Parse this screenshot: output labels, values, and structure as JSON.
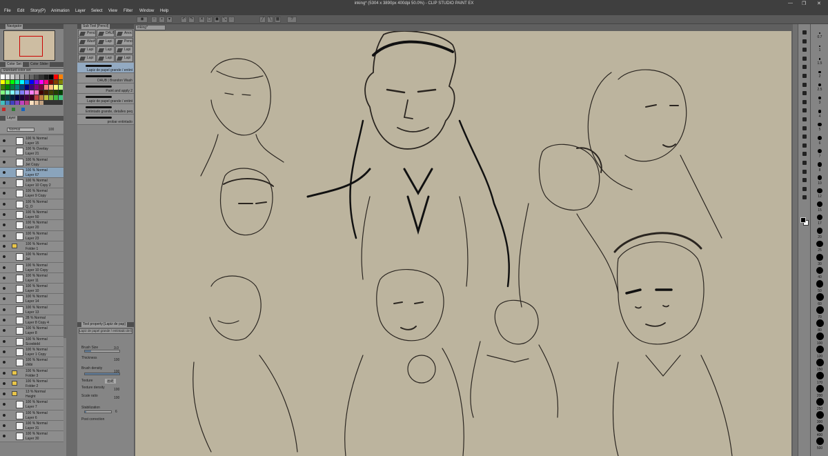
{
  "window": {
    "title": "inking* (5304 x 3890px 400dpi 50.0%) - CLIP STUDIO PAINT EX",
    "controls": [
      "—",
      "❐",
      "✕"
    ]
  },
  "menu": [
    "File",
    "Edit",
    "Story(P)",
    "Animation",
    "Layer",
    "Select",
    "View",
    "Filter",
    "Window",
    "Help"
  ],
  "navigator": {
    "title": "Navigator"
  },
  "colorset": {
    "tabs": [
      "Color Set",
      "Color Slider"
    ],
    "selected": "Standard color set"
  },
  "colors": [
    "#ffffff",
    "#e6e6e6",
    "#cccccc",
    "#b3b3b3",
    "#999999",
    "#808080",
    "#666666",
    "#4d4d4d",
    "#333333",
    "#1a1a1a",
    "#000000",
    "#ff0000",
    "#ff8000",
    "#ffff00",
    "#80ff00",
    "#00ff00",
    "#00ff80",
    "#00ffff",
    "#0080ff",
    "#0000ff",
    "#8000ff",
    "#ff00ff",
    "#ff0080",
    "#800000",
    "#804000",
    "#808000",
    "#408000",
    "#008000",
    "#008040",
    "#008080",
    "#004080",
    "#000080",
    "#400080",
    "#800080",
    "#800040",
    "#ff8080",
    "#ffc080",
    "#ffff80",
    "#c0ff80",
    "#80ff80",
    "#80ffc0",
    "#80ffff",
    "#80c0ff",
    "#8080ff",
    "#c080ff",
    "#ff80ff",
    "#ff80c0",
    "#400000",
    "#402000",
    "#404000",
    "#204000",
    "#004000",
    "#004020",
    "#004040",
    "#002040",
    "#000040",
    "#200040",
    "#400040",
    "#400020",
    "#c04040",
    "#c08040",
    "#c0c040",
    "#80c040",
    "#40c040",
    "#40c080",
    "#40c0c0",
    "#4080c0",
    "#4040c0",
    "#8040c0",
    "#c040c0",
    "#c04080",
    "#ffe0c0",
    "#e0c0a0",
    "#c0a080"
  ],
  "layer": {
    "tab": "Layer",
    "blend_mode": "Normal",
    "opacity": "100",
    "rows": [
      {
        "line1": "100 % Normal",
        "line2": "Layer 15",
        "folder": false,
        "selected": false
      },
      {
        "line1": "100 % Overlay",
        "line2": "Layer 21",
        "folder": false,
        "selected": false
      },
      {
        "line1": "100 % Normal",
        "line2": "Jet Copy",
        "folder": false,
        "selected": false
      },
      {
        "line1": "100 % Normal",
        "line2": "Layer 67",
        "folder": false,
        "selected": true
      },
      {
        "line1": "100 % Normal",
        "line2": "Layer 10 Copy 2",
        "folder": false,
        "selected": false
      },
      {
        "line1": "100 % Normal",
        "line2": "Layer 9 Copy",
        "folder": false,
        "selected": false
      },
      {
        "line1": "100 % Normal",
        "line2": "Q_O",
        "folder": false,
        "selected": false
      },
      {
        "line1": "100 % Normal",
        "line2": "Layer 50",
        "folder": false,
        "selected": false
      },
      {
        "line1": "100 % Normal",
        "line2": "Layer 20",
        "folder": false,
        "selected": false
      },
      {
        "line1": "100 % Normal",
        "line2": "Layer 23",
        "folder": false,
        "selected": false
      },
      {
        "line1": "100 % Normal",
        "line2": "Folder 1",
        "folder": true,
        "selected": false
      },
      {
        "line1": "100 % Normal",
        "line2": "Jet",
        "folder": false,
        "selected": false
      },
      {
        "line1": "100 % Normal",
        "line2": "Layer 10 Copy",
        "folder": false,
        "selected": false
      },
      {
        "line1": "100 % Normal",
        "line2": "Layer 11",
        "folder": false,
        "selected": false
      },
      {
        "line1": "100 % Normal",
        "line2": "Layer 10",
        "folder": false,
        "selected": false
      },
      {
        "line1": "100 % Normal",
        "line2": "Layer 14",
        "folder": false,
        "selected": false
      },
      {
        "line1": "100 % Normal",
        "line2": "Layer 13",
        "folder": false,
        "selected": false
      },
      {
        "line1": "28 % Normal",
        "line2": "Layer 8 Copy 4",
        "folder": false,
        "selected": false
      },
      {
        "line1": "100 % Normal",
        "line2": "Layer 8",
        "folder": false,
        "selected": false
      },
      {
        "line1": "100 % Normal",
        "line2": "Scoobidd",
        "folder": false,
        "selected": false
      },
      {
        "line1": "100 % Normal",
        "line2": "Layer 1 Copy",
        "folder": false,
        "selected": false
      },
      {
        "line1": "100 % Normal",
        "line2": "chibi",
        "folder": false,
        "selected": false
      },
      {
        "line1": "100 % Normal",
        "line2": "Folder 3",
        "folder": true,
        "selected": false
      },
      {
        "line1": "100 % Normal",
        "line2": "Folder 2",
        "folder": true,
        "selected": false
      },
      {
        "line1": "13 % Normal",
        "line2": "Height",
        "folder": true,
        "selected": false
      },
      {
        "line1": "100 % Normal",
        "line2": "Layer 7",
        "folder": false,
        "selected": false
      },
      {
        "line1": "100 % Normal",
        "line2": "Layer 6",
        "folder": false,
        "selected": false
      },
      {
        "line1": "100 % Normal",
        "line2": "Layer 31",
        "folder": false,
        "selected": false
      },
      {
        "line1": "100 % Normal",
        "line2": "Layer 30",
        "folder": false,
        "selected": false
      }
    ]
  },
  "subtool": {
    "tab": "Sub Tool [Pencil]",
    "tools": [
      "Pencil",
      "DAUB",
      "Anoc",
      "Wash",
      "Lapi",
      "Penci",
      "Lapi",
      "Lapi",
      "Lapi",
      "Lapi",
      "Lapi",
      "Lapi",
      "Lapi"
    ],
    "brushes": [
      {
        "name": "Lapiz de papel grande / entint",
        "selected": true
      },
      {
        "name": "DAUB | Brandon Wash",
        "selected": false
      },
      {
        "name": "Paint and apply 2",
        "selected": false
      },
      {
        "name": "Lapiz de papel grande / entint",
        "selected": false
      },
      {
        "name": "Entintado grande, detalles peq",
        "selected": false
      },
      {
        "name": "probar entintado",
        "selected": false
      }
    ]
  },
  "toolprop": {
    "tab": "Tool property [Lapiz de pap]",
    "preview": "Lapiz de papel grande / entintado de boceto 2",
    "brush_size": {
      "label": "Brush Size",
      "value": "3.0"
    },
    "thickness": {
      "label": "Thickness",
      "value": "100"
    },
    "brush_density": {
      "label": "Brush density",
      "value": "100"
    },
    "texture": {
      "label": "Texture",
      "value": "画紙"
    },
    "texture_density": {
      "label": "Texture density",
      "value": "100"
    },
    "scale_ratio": {
      "label": "Scale ratio",
      "value": "100"
    },
    "stabilization": {
      "label": "Stabilization",
      "value": "6"
    },
    "post_correction": {
      "label": "Post correction"
    }
  },
  "document": {
    "tab": "inking*"
  },
  "sizes": [
    "0.7",
    "1",
    "1.5",
    "2",
    "2.5",
    "3",
    "4",
    "5",
    "6",
    "7",
    "8",
    "10",
    "12",
    "15",
    "17",
    "20",
    "25",
    "30",
    "40",
    "50",
    "60",
    "70",
    "80",
    "100",
    "120",
    "150",
    "170",
    "200",
    "250",
    "300",
    "400",
    "500"
  ]
}
